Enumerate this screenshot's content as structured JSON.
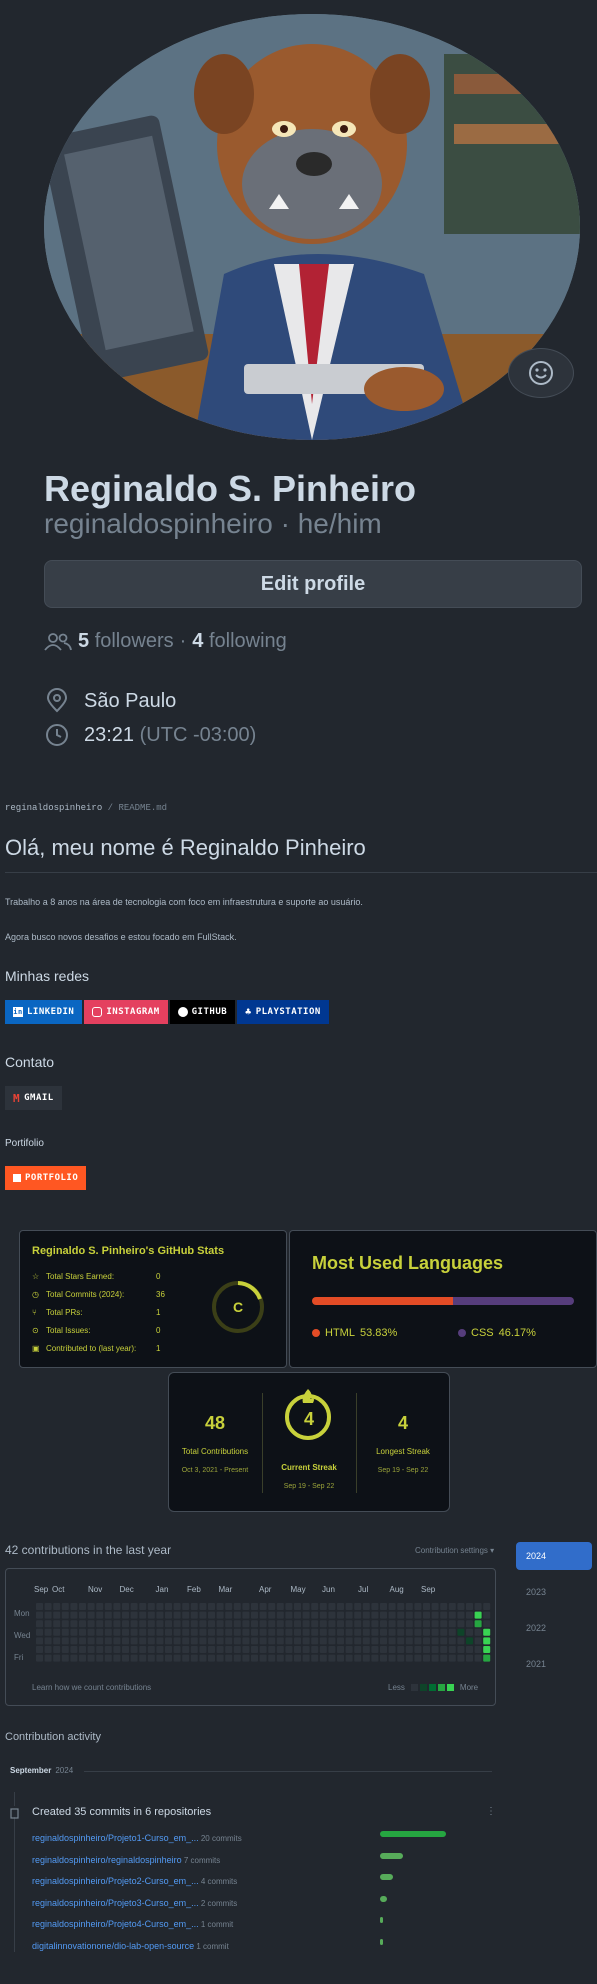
{
  "profile": {
    "name": "Reginaldo S. Pinheiro",
    "login_line": "reginaldospinheiro · he/him",
    "edit_label": "Edit profile",
    "followers_count": "5",
    "followers_label": "followers",
    "following_count": "4",
    "following_label": "following",
    "location": "São Paulo",
    "time": "23:21",
    "timezone": "(UTC -03:00)"
  },
  "readme": {
    "path_user": "reginaldospinheiro",
    "path_sep": "/",
    "path_file": "README.md",
    "heading": "Olá, meu nome é Reginaldo Pinheiro",
    "para1": "Trabalho a 8 anos na área de tecnologia com foco em infraestrutura e suporte ao usuário.",
    "para2": "Agora busco novos desafios e estou focado em FullStack.",
    "networks_title": "Minhas redes",
    "badges": [
      "LINKEDIN",
      "INSTAGRAM",
      "GITHUB",
      "PLAYSTATION"
    ],
    "contact_title": "Contato",
    "gmail_badge": "GMAIL",
    "portfolio_title": "Portifolio",
    "portfolio_badge": "PORTFOLIO"
  },
  "stats_card": {
    "title": "Reginaldo S. Pinheiro's GitHub Stats",
    "rows": [
      {
        "label": "Total Stars Earned:",
        "value": "0"
      },
      {
        "label": "Total Commits (2024):",
        "value": "36"
      },
      {
        "label": "Total PRs:",
        "value": "1"
      },
      {
        "label": "Total Issues:",
        "value": "0"
      },
      {
        "label": "Contributed to (last year):",
        "value": "1"
      }
    ],
    "rank": "C"
  },
  "languages_card": {
    "title": "Most Used Languages",
    "languages": [
      {
        "name": "HTML",
        "percent": "53.83%",
        "value": 53.83,
        "color": "#e34c26"
      },
      {
        "name": "CSS",
        "percent": "46.17%",
        "value": 46.17,
        "color": "#563d7c"
      }
    ]
  },
  "streak_card": {
    "total_value": "48",
    "total_label": "Total Contributions",
    "total_range": "Oct 3, 2021 - Present",
    "current_value": "4",
    "current_label": "Current Streak",
    "current_range": "Sep 19 - Sep 22",
    "longest_value": "4",
    "longest_label": "Longest Streak",
    "longest_range": "Sep 19 - Sep 22"
  },
  "contributions": {
    "title": "42 contributions in the last year",
    "settings": "Contribution settings ▾",
    "months": [
      "Sep",
      "Oct",
      "Nov",
      "Dec",
      "Jan",
      "Feb",
      "Mar",
      "Apr",
      "May",
      "Jun",
      "Jul",
      "Aug",
      "Sep"
    ],
    "days": [
      "Mon",
      "Wed",
      "Fri"
    ],
    "learn": "Learn how we count contributions",
    "less": "Less",
    "more": "More",
    "years": [
      "2024",
      "2023",
      "2022",
      "2021"
    ]
  },
  "activity": {
    "title": "Contribution activity",
    "month": "September",
    "year": "2024",
    "summary": "Created 35 commits in 6 repositories",
    "repos": [
      {
        "name": "reginaldospinheiro/Projeto1-Curso_em_...",
        "count": "20 commits",
        "commits": 20
      },
      {
        "name": "reginaldospinheiro/reginaldospinheiro",
        "count": "7 commits",
        "commits": 7
      },
      {
        "name": "reginaldospinheiro/Projeto2-Curso_em_...",
        "count": "4 commits",
        "commits": 4
      },
      {
        "name": "reginaldospinheiro/Projeto3-Curso_em_...",
        "count": "2 commits",
        "commits": 2
      },
      {
        "name": "reginaldospinheiro/Projeto4-Curso_em_...",
        "count": "1 commit",
        "commits": 1
      },
      {
        "name": "digitalinnovationone/dio-lab-open-source",
        "count": "1 commit",
        "commits": 1
      }
    ]
  }
}
